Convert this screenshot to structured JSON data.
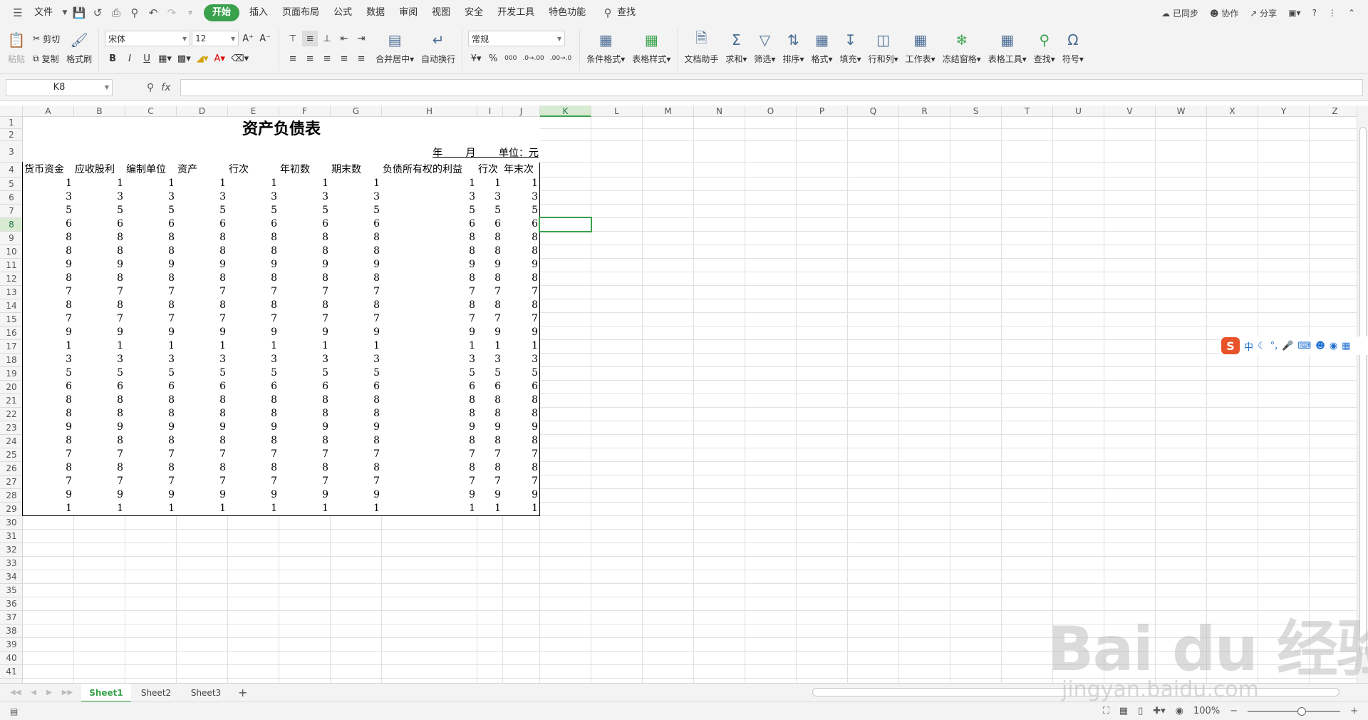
{
  "menubar": {
    "file_label": "文件",
    "tabs": [
      "开始",
      "插入",
      "页面布局",
      "公式",
      "数据",
      "审阅",
      "视图",
      "安全",
      "开发工具",
      "特色功能"
    ],
    "search_label": "查找",
    "right": [
      "已同步",
      "协作",
      "分享"
    ],
    "help": "?"
  },
  "ribbon": {
    "paste": "粘贴",
    "cut": "剪切",
    "copy": "复制",
    "format_painter": "格式刷",
    "font_name": "宋体",
    "font_size": "12",
    "bold": "B",
    "italic": "I",
    "underline": "U",
    "merge_center": "合并居中",
    "wrap_text": "自动换行",
    "number_format": "常规",
    "percent": "%",
    "thousands": "000",
    "inc_dec": ".0→.00",
    "dec_dec": ".00→.0",
    "conditional_format": "条件格式",
    "table_style": "表格样式",
    "doc_assistant": "文档助手",
    "sum": "求和",
    "filter": "筛选",
    "sort": "排序",
    "format": "格式",
    "fill": "填充",
    "row_col": "行和列",
    "worksheet": "工作表",
    "freeze": "冻结窗格",
    "table_tools": "表格工具",
    "find": "查找",
    "symbol": "符号"
  },
  "formula_bar": {
    "name_box": "K8",
    "fx": "fx",
    "value": ""
  },
  "columns": [
    "A",
    "B",
    "C",
    "D",
    "E",
    "F",
    "G",
    "H",
    "I",
    "J",
    "K",
    "L",
    "M",
    "N",
    "O",
    "P",
    "Q",
    "R",
    "S",
    "T",
    "U",
    "V",
    "W",
    "X",
    "Y",
    "Z"
  ],
  "rows": [
    "1",
    "2",
    "3",
    "4",
    "5",
    "6",
    "7",
    "8",
    "9",
    "10",
    "11",
    "12",
    "13",
    "14",
    "15",
    "16",
    "17",
    "18",
    "19",
    "20",
    "21",
    "22",
    "23",
    "24",
    "25",
    "26",
    "27",
    "28",
    "29",
    "30",
    "31",
    "32",
    "33",
    "34",
    "35",
    "36",
    "37",
    "38",
    "39",
    "40",
    "41"
  ],
  "selected_cell": {
    "col": "K",
    "row": "8"
  },
  "sheet": {
    "title": "资产负债表",
    "subtitle": "年 　　月 　　单位：元",
    "headers": [
      "货币资金",
      "应收股利",
      "编制单位",
      "资产",
      "行次",
      "年初数",
      "期末数",
      "负债所有权的利益",
      "行次",
      "年末次"
    ],
    "rows": [
      [
        1,
        1,
        1,
        1,
        1,
        1,
        1,
        1,
        1,
        1
      ],
      [
        3,
        3,
        3,
        3,
        3,
        3,
        3,
        3,
        3,
        3
      ],
      [
        5,
        5,
        5,
        5,
        5,
        5,
        5,
        5,
        5,
        5
      ],
      [
        6,
        6,
        6,
        6,
        6,
        6,
        6,
        6,
        6,
        6
      ],
      [
        8,
        8,
        8,
        8,
        8,
        8,
        8,
        8,
        8,
        8
      ],
      [
        8,
        8,
        8,
        8,
        8,
        8,
        8,
        8,
        8,
        8
      ],
      [
        9,
        9,
        9,
        9,
        9,
        9,
        9,
        9,
        9,
        9
      ],
      [
        8,
        8,
        8,
        8,
        8,
        8,
        8,
        8,
        8,
        8
      ],
      [
        7,
        7,
        7,
        7,
        7,
        7,
        7,
        7,
        7,
        7
      ],
      [
        8,
        8,
        8,
        8,
        8,
        8,
        8,
        8,
        8,
        8
      ],
      [
        7,
        7,
        7,
        7,
        7,
        7,
        7,
        7,
        7,
        7
      ],
      [
        9,
        9,
        9,
        9,
        9,
        9,
        9,
        9,
        9,
        9
      ],
      [
        1,
        1,
        1,
        1,
        1,
        1,
        1,
        1,
        1,
        1
      ],
      [
        3,
        3,
        3,
        3,
        3,
        3,
        3,
        3,
        3,
        3
      ],
      [
        5,
        5,
        5,
        5,
        5,
        5,
        5,
        5,
        5,
        5
      ],
      [
        6,
        6,
        6,
        6,
        6,
        6,
        6,
        6,
        6,
        6
      ],
      [
        8,
        8,
        8,
        8,
        8,
        8,
        8,
        8,
        8,
        8
      ],
      [
        8,
        8,
        8,
        8,
        8,
        8,
        8,
        8,
        8,
        8
      ],
      [
        9,
        9,
        9,
        9,
        9,
        9,
        9,
        9,
        9,
        9
      ],
      [
        8,
        8,
        8,
        8,
        8,
        8,
        8,
        8,
        8,
        8
      ],
      [
        7,
        7,
        7,
        7,
        7,
        7,
        7,
        7,
        7,
        7
      ],
      [
        8,
        8,
        8,
        8,
        8,
        8,
        8,
        8,
        8,
        8
      ],
      [
        7,
        7,
        7,
        7,
        7,
        7,
        7,
        7,
        7,
        7
      ],
      [
        9,
        9,
        9,
        9,
        9,
        9,
        9,
        9,
        9,
        9
      ],
      [
        1,
        1,
        1,
        1,
        1,
        1,
        1,
        1,
        1,
        1
      ]
    ]
  },
  "sheet_tabs": [
    "Sheet1",
    "Sheet2",
    "Sheet3"
  ],
  "active_sheet": "Sheet1",
  "status": {
    "zoom": "100%"
  },
  "ime": {
    "lang": "中"
  },
  "watermark": {
    "brand": "Bai du 经验",
    "url": "jingyan.baidu.com"
  },
  "colors": {
    "accent": "#3aa24c",
    "ime_logo": "#e8532a"
  }
}
